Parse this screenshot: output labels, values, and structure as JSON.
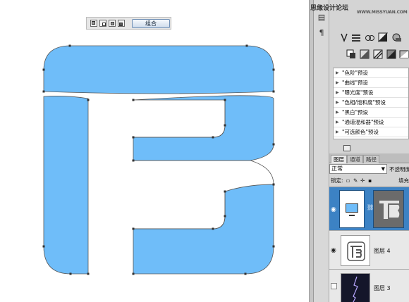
{
  "watermark": {
    "chinese": "思缘设计论坛",
    "url": "WWW.MISSYUAN.COM"
  },
  "path_toolbar": {
    "combine_label": "组合"
  },
  "adjustment_presets": [
    "\"色阶\"预设",
    "\"曲线\"预设",
    "\"曝光度\"预设",
    "\"色相/饱和度\"预设",
    "\"黑白\"预设",
    "\"通道混和器\"预设",
    "\"可选颜色\"预设"
  ],
  "layers_panel": {
    "tabs": [
      "图层",
      "通道",
      "路径"
    ],
    "blend_mode": "正常",
    "opacity_label": "不透明度",
    "lock_label": "锁定:",
    "fill_label": "填充",
    "layers": [
      {
        "name": "",
        "selected": true,
        "visible": true
      },
      {
        "name": "图层 4",
        "selected": false,
        "visible": true
      },
      {
        "name": "图层 3",
        "selected": false,
        "visible": false
      }
    ]
  },
  "colors": {
    "shape_fill": "#6fbdf9",
    "panel_bg": "#d4d4d4",
    "selected_layer": "#3c82c4"
  }
}
